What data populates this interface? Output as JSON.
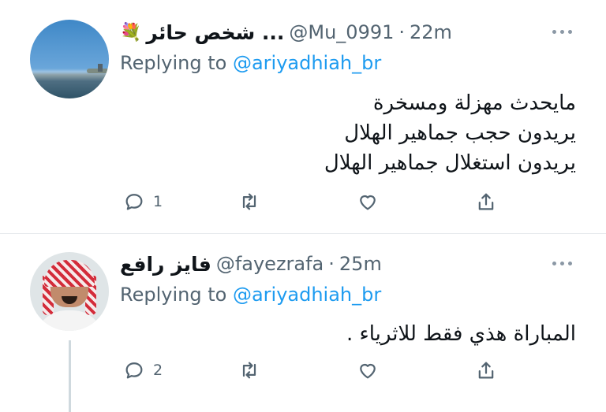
{
  "tweets": [
    {
      "display_name": "شخص حائر ...",
      "emoji": "💐",
      "handle": "@Mu_0991",
      "separator": "·",
      "time": "22m",
      "replying_prefix": "Replying to",
      "replying_handle": "@ariyadhiah_br",
      "lines": [
        "مايحدث مهزلة ومسخرة",
        "يريدون حجب جماهير الهلال",
        "يريدون استغلال جماهير الهلال"
      ],
      "reply_count": "1",
      "retweet_count": "",
      "like_count": ""
    },
    {
      "display_name": "فايز رافع",
      "emoji": "",
      "handle": "@fayezrafa",
      "separator": "·",
      "time": "25m",
      "replying_prefix": "Replying to",
      "replying_handle": "@ariyadhiah_br",
      "lines": [
        "المباراة هذي فقط للاثرياء ."
      ],
      "reply_count": "2",
      "retweet_count": "",
      "like_count": ""
    }
  ],
  "icons": {
    "reply": "reply-icon",
    "retweet": "retweet-icon",
    "like": "heart-icon",
    "share": "share-icon",
    "more": "more-icon"
  },
  "colors": {
    "link": "#1d9bf0",
    "secondary_text": "#536471",
    "primary_text": "#0f1419"
  }
}
